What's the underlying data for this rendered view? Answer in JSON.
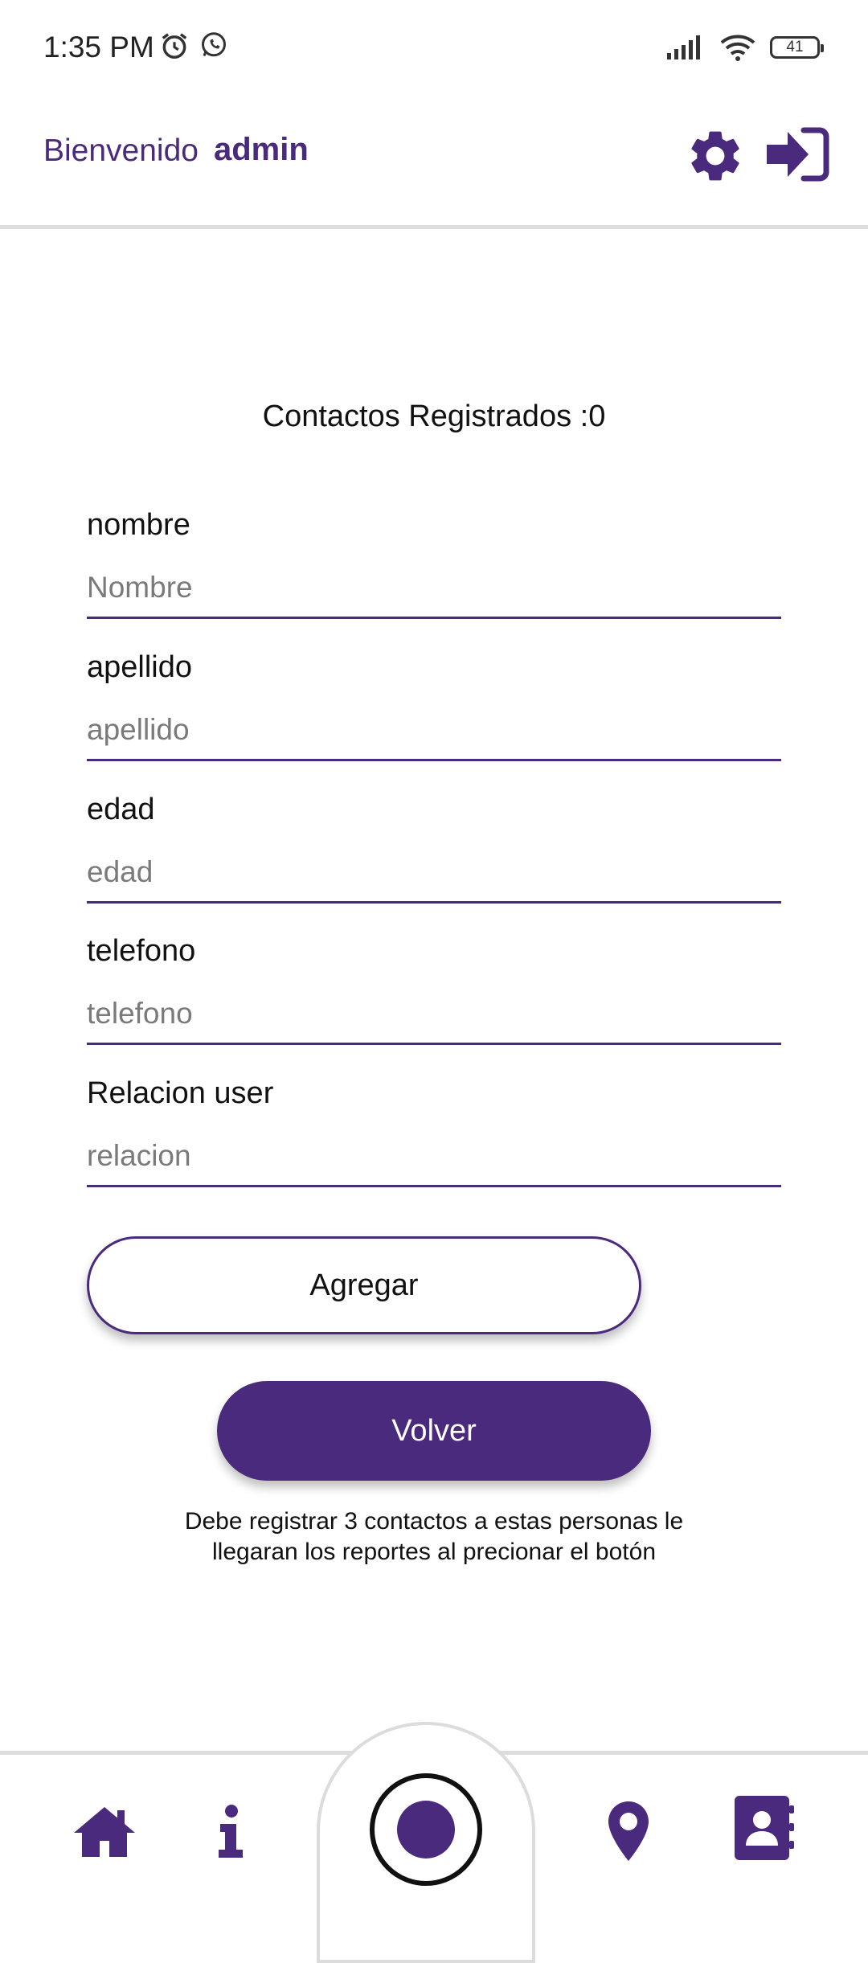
{
  "status_bar": {
    "time": "1:35 PM",
    "battery": "41",
    "icons": [
      "alarm-icon",
      "whatsapp-icon",
      "signal-icon",
      "wifi-icon",
      "battery-icon"
    ]
  },
  "header": {
    "greeting": "Bienvenido",
    "username": "admin",
    "icons": [
      "gear-icon",
      "sign-in-icon"
    ]
  },
  "contacts_count": "Contactos Registrados :0",
  "form": {
    "fields": [
      {
        "label": "nombre",
        "placeholder": "Nombre"
      },
      {
        "label": "apellido",
        "placeholder": "apellido"
      },
      {
        "label": "edad",
        "placeholder": "edad"
      },
      {
        "label": "telefono",
        "placeholder": "telefono"
      },
      {
        "label": "Relacion user",
        "placeholder": "relacion"
      }
    ],
    "add_label": "Agregar",
    "back_label": "Volver"
  },
  "note": "Debe registrar 3 contactos a estas personas le llegaran los reportes al precionar el botón",
  "bottom_nav": {
    "items": [
      "home-icon",
      "info-icon",
      "panic-button",
      "map-pin-icon",
      "contacts-book-icon"
    ]
  },
  "colors": {
    "accent": "#4a2a7c",
    "divider": "#dddddd"
  }
}
